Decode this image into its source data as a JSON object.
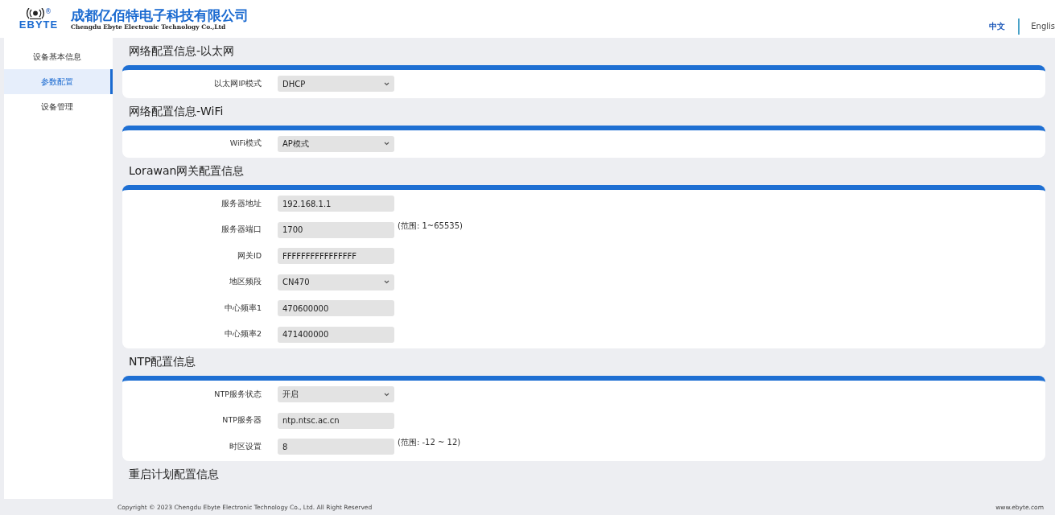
{
  "header": {
    "logo_mark": "®",
    "logo_text": "EBYTE",
    "company_name": "成都亿佰特电子科技有限公司",
    "company_name_en": "Chengdu Ebyte Electronic Technology Co.,Ltd",
    "languages": [
      {
        "label": "中文",
        "selected": true
      },
      {
        "label": "Englis",
        "selected": false
      }
    ]
  },
  "sidebar": {
    "items": [
      {
        "label": "设备基本信息",
        "selected": false
      },
      {
        "label": "参数配置",
        "selected": true
      },
      {
        "label": "设备管理",
        "selected": false
      }
    ]
  },
  "sections": [
    {
      "title": "网络配置信息-以太网",
      "fields": [
        {
          "kind": "select",
          "label": "以太网IP模式",
          "value": "DHCP"
        }
      ]
    },
    {
      "title": "网络配置信息-WiFi",
      "fields": [
        {
          "kind": "select",
          "label": "WiFi模式",
          "value": "AP模式"
        }
      ]
    },
    {
      "title": "Lorawan网关配置信息",
      "fields": [
        {
          "kind": "input",
          "label": "服务器地址",
          "value": "192.168.1.1"
        },
        {
          "kind": "input",
          "label": "服务器端口",
          "value": "1700",
          "note": "(范围: 1~65535)"
        },
        {
          "kind": "input",
          "label": "网关ID",
          "value": "FFFFFFFFFFFFFFFF"
        },
        {
          "kind": "select",
          "label": "地区频段",
          "value": "CN470"
        },
        {
          "kind": "input",
          "label": "中心频率1",
          "value": "470600000"
        },
        {
          "kind": "input",
          "label": "中心频率2",
          "value": "471400000"
        }
      ]
    },
    {
      "title": "NTP配置信息",
      "fields": [
        {
          "kind": "select",
          "label": "NTP服务状态",
          "value": "开启"
        },
        {
          "kind": "input",
          "label": "NTP服务器",
          "value": "ntp.ntsc.ac.cn"
        },
        {
          "kind": "input",
          "label": "时区设置",
          "value": "8",
          "note": "(范围: -12 ~ 12)"
        }
      ]
    },
    {
      "title": "重启计划配置信息"
    }
  ],
  "footer": {
    "copyright": "Copyright © 2023 Chengdu Ebyte Electronic Technology Co., Ltd. All Right Reserved",
    "website": "www.ebyte.com"
  }
}
